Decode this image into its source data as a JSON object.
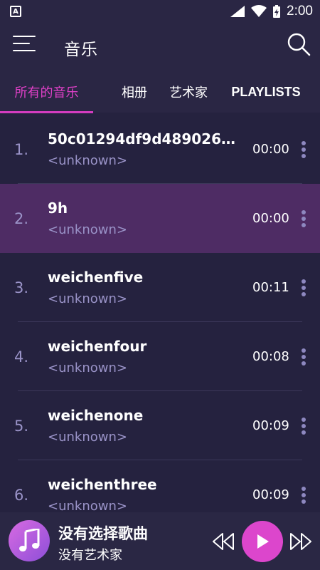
{
  "status_bar": {
    "time": "2:00",
    "left_badge": "A"
  },
  "app_bar": {
    "title": "音乐"
  },
  "tabs": [
    {
      "label": "所有的音乐",
      "active": true
    },
    {
      "label": "相册",
      "active": false
    },
    {
      "label": "艺术家",
      "active": false
    },
    {
      "label": "PLAYLISTS",
      "active": false
    }
  ],
  "songs": [
    {
      "index": "1.",
      "title": "50c01294df9d4890263…",
      "artist": "<unknown>",
      "duration": "00:00",
      "selected": false
    },
    {
      "index": "2.",
      "title": "9h",
      "artist": "<unknown>",
      "duration": "00:00",
      "selected": true
    },
    {
      "index": "3.",
      "title": "weichenfive",
      "artist": "<unknown>",
      "duration": "00:11",
      "selected": false
    },
    {
      "index": "4.",
      "title": "weichenfour",
      "artist": "<unknown>",
      "duration": "00:08",
      "selected": false
    },
    {
      "index": "5.",
      "title": "weichenone",
      "artist": "<unknown>",
      "duration": "00:09",
      "selected": false
    },
    {
      "index": "6.",
      "title": "weichenthree",
      "artist": "<unknown>",
      "duration": "00:09",
      "selected": false
    }
  ],
  "player": {
    "title": "没有选择歌曲",
    "artist": "没有艺术家"
  },
  "colors": {
    "background": "#25223f",
    "bar": "#2a2644",
    "accent": "#e040c8",
    "selected_row": "#4e2c64",
    "muted_text": "#9a93c8"
  },
  "icons": {
    "menu": "hamburger-icon",
    "search": "search-icon",
    "more": "more-vert-icon",
    "prev": "rewind-icon",
    "play": "play-icon",
    "next": "fast-forward-icon",
    "cover": "music-note-icon"
  }
}
